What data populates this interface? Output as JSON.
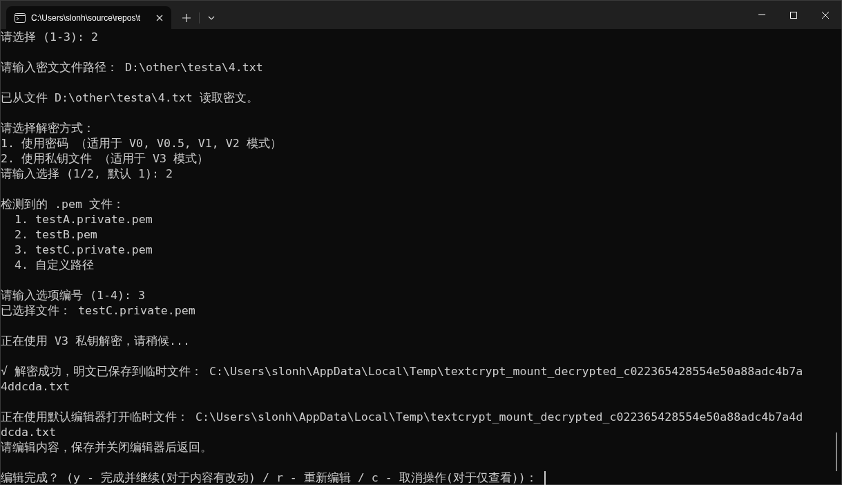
{
  "window": {
    "tab_title": "C:\\Users\\slonh\\source\\repos\\t"
  },
  "terminal": {
    "blocks": [
      [
        "请选择 (1-3): 2"
      ],
      [
        "请输入密文文件路径： D:\\other\\testa\\4.txt"
      ],
      [
        "已从文件 D:\\other\\testa\\4.txt 读取密文。"
      ],
      [
        "请选择解密方式：",
        "1. 使用密码 （适用于 V0, V0.5, V1, V2 模式）",
        "2. 使用私钥文件 （适用于 V3 模式）",
        "请输入选择 (1/2, 默认 1): 2"
      ],
      [
        "检测到的 .pem 文件：",
        "  1. testA.private.pem",
        "  2. testB.pem",
        "  3. testC.private.pem",
        "  4. 自定义路径"
      ],
      [
        "请输入选项编号 (1-4): 3",
        "已选择文件： testC.private.pem"
      ],
      [
        "正在使用 V3 私钥解密，请稍候..."
      ],
      [
        "√ 解密成功，明文已保存到临时文件： C:\\Users\\slonh\\AppData\\Local\\Temp\\textcrypt_mount_decrypted_c022365428554e50a88adc4b7a",
        "4ddcda.txt"
      ],
      [
        "正在使用默认编辑器打开临时文件： C:\\Users\\slonh\\AppData\\Local\\Temp\\textcrypt_mount_decrypted_c022365428554e50a88adc4b7a4d",
        "dcda.txt",
        "请编辑内容，保存并关闭编辑器后返回。"
      ],
      [
        "编辑完成？ (y - 完成并继续(对于内容有改动) / r - 重新编辑 / c - 取消操作(对于仅查看))： "
      ]
    ]
  }
}
